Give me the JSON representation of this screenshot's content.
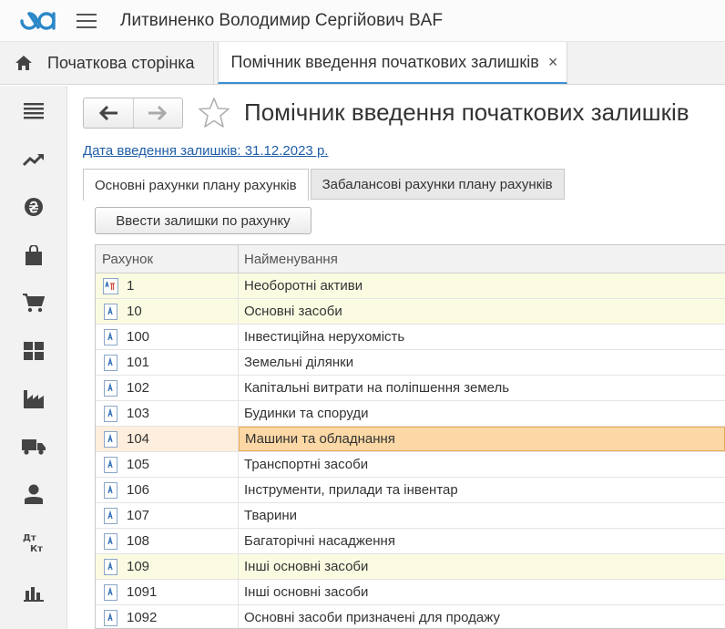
{
  "app": {
    "title": "Литвиненко Володимир Сергійович BAF"
  },
  "tabs_bar": {
    "home_label": "Початкова сторінка",
    "active_label": "Помічник введення початкових залишків",
    "close_glyph": "×"
  },
  "sidebar": {
    "items": [
      {
        "name": "menu-list-icon"
      },
      {
        "name": "trend-chart-icon"
      },
      {
        "name": "currency-icon"
      },
      {
        "name": "shopping-bag-icon"
      },
      {
        "name": "cart-icon"
      },
      {
        "name": "warehouse-icon"
      },
      {
        "name": "factory-icon"
      },
      {
        "name": "truck-icon"
      },
      {
        "name": "person-icon"
      },
      {
        "name": "dt-kt-icon"
      },
      {
        "name": "bar-chart-icon"
      }
    ],
    "dtkt_top": "Дт",
    "dtkt_bottom": "Кт"
  },
  "page": {
    "title": "Помічник введення початкових залишків",
    "date_link": "Дата введення залишків: 31.12.2023 р.",
    "tab_main": "Основні рахунки плану рахунків",
    "tab_offbalance": "Забалансові рахунки плану рахунків",
    "enter_button": "Ввести залишки по рахунку"
  },
  "grid": {
    "col_code": "Рахунок",
    "col_name": "Найменування",
    "rows": [
      {
        "code": "1",
        "name": "Необоротні активи",
        "style": "hl",
        "icon": "group"
      },
      {
        "code": "10",
        "name": "Основні засоби",
        "style": "hl",
        "icon": "item"
      },
      {
        "code": "100",
        "name": "Інвестиційна нерухомість",
        "style": "",
        "icon": "item"
      },
      {
        "code": "101",
        "name": "Земельні ділянки",
        "style": "",
        "icon": "item"
      },
      {
        "code": "102",
        "name": "Капітальні витрати на поліпшення  земель",
        "style": "",
        "icon": "item"
      },
      {
        "code": "103",
        "name": "Будинки та споруди",
        "style": "",
        "icon": "item"
      },
      {
        "code": "104",
        "name": "Машини та обладнання",
        "style": "sel",
        "icon": "item"
      },
      {
        "code": "105",
        "name": "Транспортні засоби",
        "style": "",
        "icon": "item"
      },
      {
        "code": "106",
        "name": "Інструменти, прилади та інвентар",
        "style": "",
        "icon": "item"
      },
      {
        "code": "107",
        "name": "Тварини",
        "style": "",
        "icon": "item"
      },
      {
        "code": "108",
        "name": "Багаторічні насадження",
        "style": "",
        "icon": "item"
      },
      {
        "code": "109",
        "name": "Інші основні засоби",
        "style": "hl",
        "icon": "item"
      },
      {
        "code": "1091",
        "name": "Інші основні засоби",
        "style": "",
        "icon": "item"
      },
      {
        "code": "1092",
        "name": "Основні засоби призначені для продажу",
        "style": "",
        "icon": "item"
      }
    ]
  }
}
